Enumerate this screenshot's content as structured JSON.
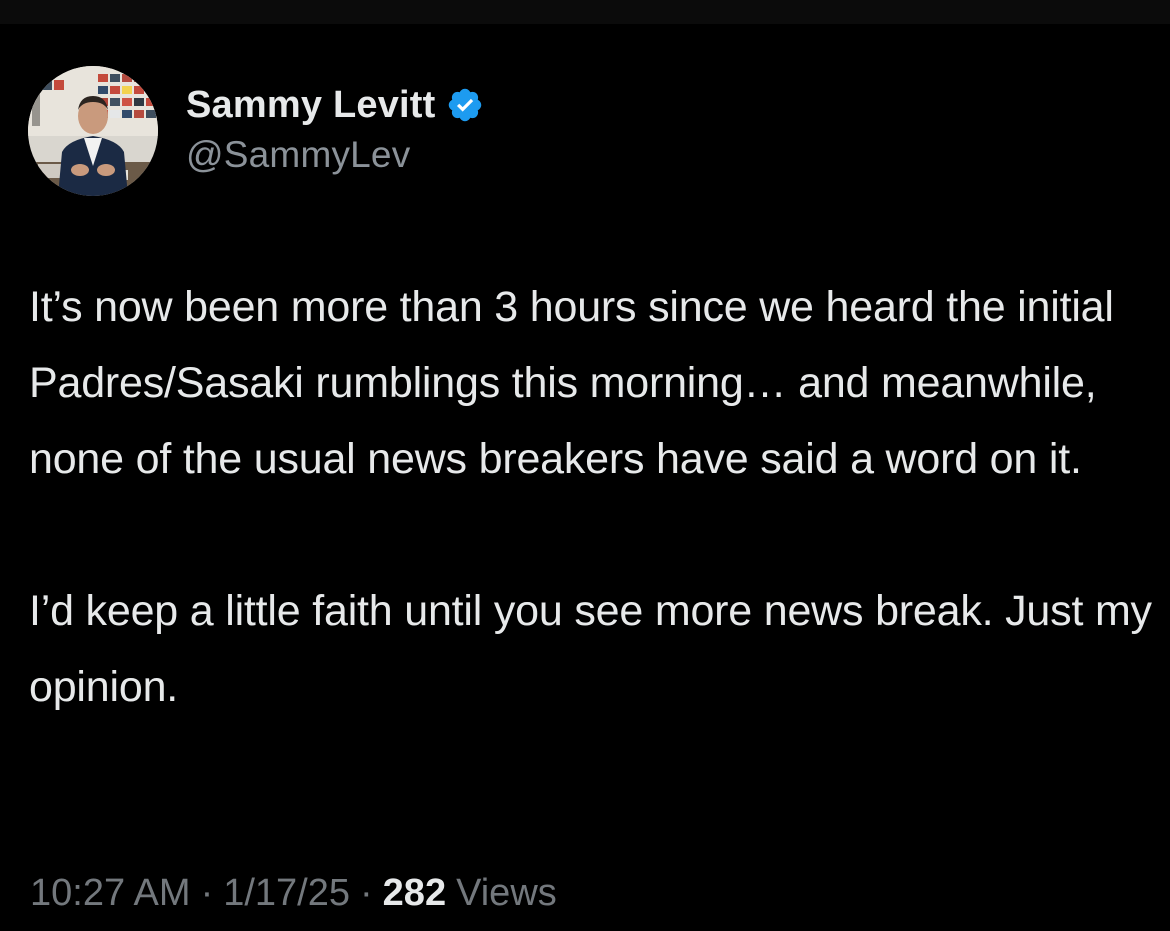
{
  "colors": {
    "background": "#000000",
    "text_primary": "#e7e9ea",
    "text_secondary": "#73787d",
    "verified_badge": "#1d9bf0"
  },
  "author": {
    "display_name": "Sammy Levitt",
    "handle": "@SammyLev",
    "verified_icon": "verified-badge-icon",
    "avatar_icon": "profile-photo"
  },
  "tweet": {
    "text": "It’s now been more than 3 hours since we heard the initial Padres/Sasaki rumblings this morning… and meanwhile, none of the usual news breakers have said a word on it.\n\nI’d keep a little faith until you see more news break. Just my opinion.",
    "time": "10:27 AM",
    "date": "1/17/25",
    "separator": "·",
    "views_count": "282",
    "views_label": "Views"
  }
}
